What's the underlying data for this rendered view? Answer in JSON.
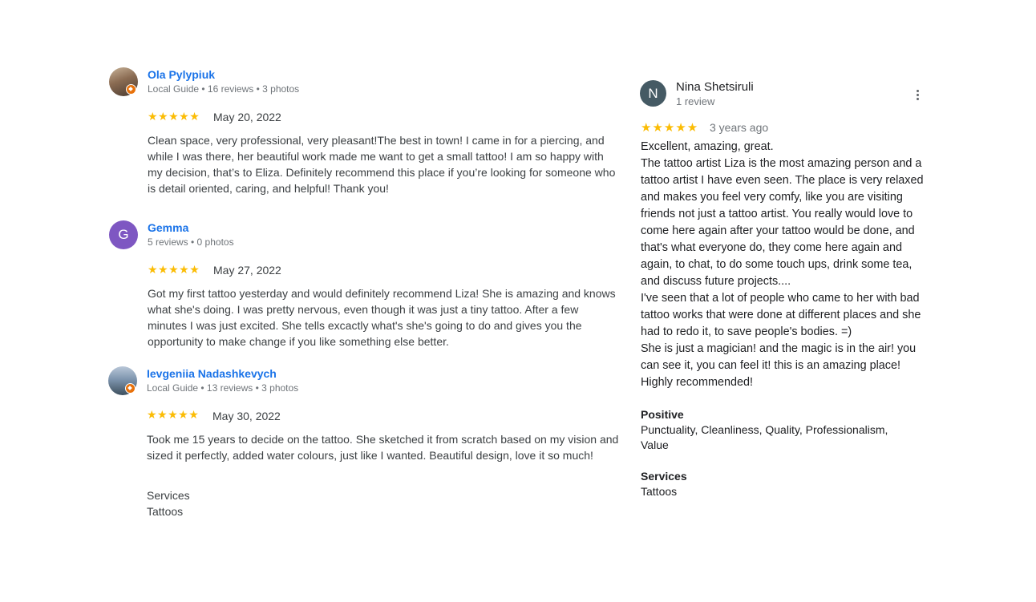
{
  "colors": {
    "name_link": "#1a73e8",
    "star": "#fbbc04",
    "meta": "#70757a",
    "avatar_gemma": "#7e57c2",
    "avatar_nina": "#455a64",
    "local_guide_badge": "#e8710a"
  },
  "reviews_left": [
    {
      "name": "Ola Pylypiuk",
      "meta": "Local Guide • 16 reviews • 3 photos",
      "stars": "★★★★★",
      "rating": 5,
      "date": "May 20, 2022",
      "text": "Clean space, very professional, very pleasant!The best in town! I came in for a piercing, and while I was there, her beautiful work made me want to get a small tattoo! I am so happy with my decision, that’s to Eliza. Definitely recommend this place if you’re looking for someone who is detail oriented, caring, and helpful! Thank you!",
      "avatar_icon": "user-photo"
    },
    {
      "name": "Gemma",
      "meta": "5 reviews • 0 photos",
      "stars": "★★★★★",
      "rating": 5,
      "date": "May 27, 2022",
      "text": "Got my first tattoo yesterday and would definitely recommend Liza! She is amazing and knows what she's doing. I was pretty nervous, even though it was just a tiny tattoo. After a few minutes I was just excited. She tells excactly what's she's going to do and gives you the opportunity to make change if you like something else better.",
      "avatar_letter": "G"
    },
    {
      "name": "Ievgeniia Nadashkevych",
      "meta": "Local Guide • 13 reviews • 3 photos",
      "stars": "★★★★★",
      "rating": 5,
      "date": "May 30, 2022",
      "text": "Took me 15 years to decide on the tattoo. She sketched it from scratch based on my vision and sized it perfectly, added water colours, just like I wanted. Beautiful design, love it so much!",
      "services_label": "Services",
      "services_value": "Tattoos",
      "avatar_icon": "user-photo"
    }
  ],
  "review_right": {
    "name": "Nina Shetsiruli",
    "avatar_letter": "N",
    "meta": "1 review",
    "stars": "★★★★★",
    "rating": 5,
    "date": "3 years ago",
    "text": "Excellent, amazing, great.\nThe tattoo artist Liza is the most amazing person and a tattoo artist I have even seen. The place is very relaxed and makes you feel very comfy, like you are visiting friends not just a tattoo artist. You really would love to come here again after your tattoo would be done, and that's what everyone do, they come here again and again, to chat, to do some touch ups, drink some tea, and discuss future projects....\nI've seen that a lot of people who came to her with bad tattoo works that were done at different places and she had to redo it, to save people's bodies. =)\nShe is just a magician! and the magic is in the air! you can see it, you can feel it! this is an amazing place!\nHighly recommended!",
    "positive_label": "Positive",
    "positive_value": "Punctuality, Cleanliness, Quality, Professionalism, Value",
    "services_label": "Services",
    "services_value": "Tattoos",
    "menu_icon": "more-vert-icon"
  }
}
